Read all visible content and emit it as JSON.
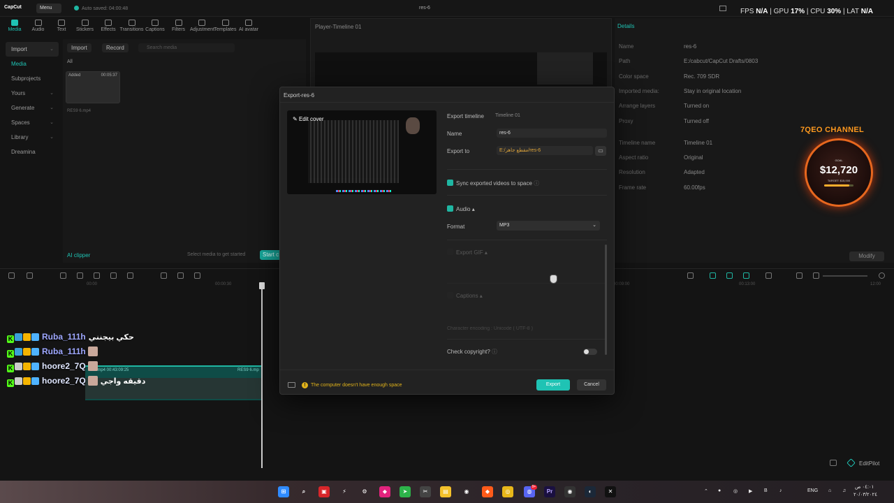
{
  "app": {
    "logo": "CapCut",
    "menu": "Menu",
    "autosave": "Auto saved: 04:00:48",
    "project_title": "res-6"
  },
  "perf": {
    "fps_label": "FPS",
    "fps": "N/A",
    "gpu_label": "GPU",
    "gpu": "17%",
    "cpu_label": "CPU",
    "cpu": "30%",
    "lat_label": "LAT",
    "lat": "N/A",
    "sep": "|"
  },
  "toolbar": [
    {
      "label": "Media",
      "icon": "media-icon",
      "active": true
    },
    {
      "label": "Audio",
      "icon": "audio-icon"
    },
    {
      "label": "Text",
      "icon": "text-icon"
    },
    {
      "label": "Stickers",
      "icon": "stickers-icon"
    },
    {
      "label": "Effects",
      "icon": "effects-icon"
    },
    {
      "label": "Transitions",
      "icon": "transitions-icon"
    },
    {
      "label": "Captions",
      "icon": "captions-icon"
    },
    {
      "label": "Filters",
      "icon": "filters-icon"
    },
    {
      "label": "Adjustment",
      "icon": "adjustment-icon"
    },
    {
      "label": "Templates",
      "icon": "templates-icon"
    },
    {
      "label": "AI avatar",
      "icon": "ai-avatar-icon"
    }
  ],
  "leftnav": [
    "Import",
    "Media",
    "Subprojects",
    "Yours",
    "Generate",
    "Spaces",
    "Library",
    "Dreamina"
  ],
  "media": {
    "import": "Import",
    "record": "Record",
    "search_placeholder": "Search media",
    "all": "All",
    "clip_added": "Added",
    "clip_duration": "00:05:37",
    "clip_name": "RES9 6.mp4",
    "ai_clipper": "AI clipper",
    "hint": "Select media to get started",
    "start": "Start c"
  },
  "player": {
    "title": "Player-Timeline 01"
  },
  "details": {
    "title": "Details",
    "rows": [
      {
        "k": "Name",
        "v": "res-6"
      },
      {
        "k": "Path",
        "v": "E:/cabcut/CapCut Drafts/0803"
      },
      {
        "k": "Color space",
        "v": "Rec. 709 SDR"
      },
      {
        "k": "Imported media:",
        "v": "Stay in original location"
      },
      {
        "k": "Arrange layers",
        "v": "Turned on"
      },
      {
        "k": "Proxy",
        "v": "Turned off"
      },
      {
        "k": "Timeline name",
        "v": "Timeline 01"
      },
      {
        "k": "Aspect ratio",
        "v": "Original"
      },
      {
        "k": "Resolution",
        "v": "Adapted"
      },
      {
        "k": "Frame rate",
        "v": "60.00fps"
      }
    ],
    "modify": "Modify"
  },
  "overlay": {
    "channel": "7QEO CHANNEL",
    "goal_label": "GOAL",
    "amount": "$12,720",
    "target": "TARGET: $15,000",
    "progress": 0.848
  },
  "timeline": {
    "ruler": [
      "00:00",
      "00:00:30",
      "00:09:00",
      "00:13:00",
      "12:00"
    ],
    "clip_label": "res6.mp4  00:43:09:25",
    "clip_label2": "RES9 6.mp"
  },
  "chat": [
    {
      "user": "Ruba_111h",
      "msg": "حكي بيجنني",
      "color": "c1"
    },
    {
      "user": "Ruba_111h",
      "msg": "",
      "color": "c1"
    },
    {
      "user": "hoore2_7Q",
      "msg": "",
      "color": ""
    },
    {
      "user": "hoore2_7Q",
      "msg": "دقيقه واجي",
      "color": ""
    }
  ],
  "dialog": {
    "title": "Export-res-6",
    "edit_cover": "Edit cover",
    "export_timeline_label": "Export timeline",
    "export_timeline_value": "Timeline 01",
    "name_label": "Name",
    "name_value": "res-6",
    "export_to_label": "Export to",
    "export_to_value": "E:/مقطع جاهز/res-6",
    "sync": "Sync exported videos to space",
    "audio": "Audio",
    "format_label": "Format",
    "format_value": "MP3",
    "gif": "Export GIF",
    "captions": "Captions",
    "captions_hint": "Character encoding : Unicode ( UTF-8 )",
    "copyright": "Check copyright?",
    "warning": "The computer doesn't have enough space",
    "export": "Export",
    "cancel": "Cancel"
  },
  "editpilot": "EditPilot",
  "taskbar": {
    "lang": "ENG",
    "time": "٠٤:٠١ ص",
    "date": "٢٠/٠٣/٢٠٢٤",
    "notif": "9+"
  }
}
